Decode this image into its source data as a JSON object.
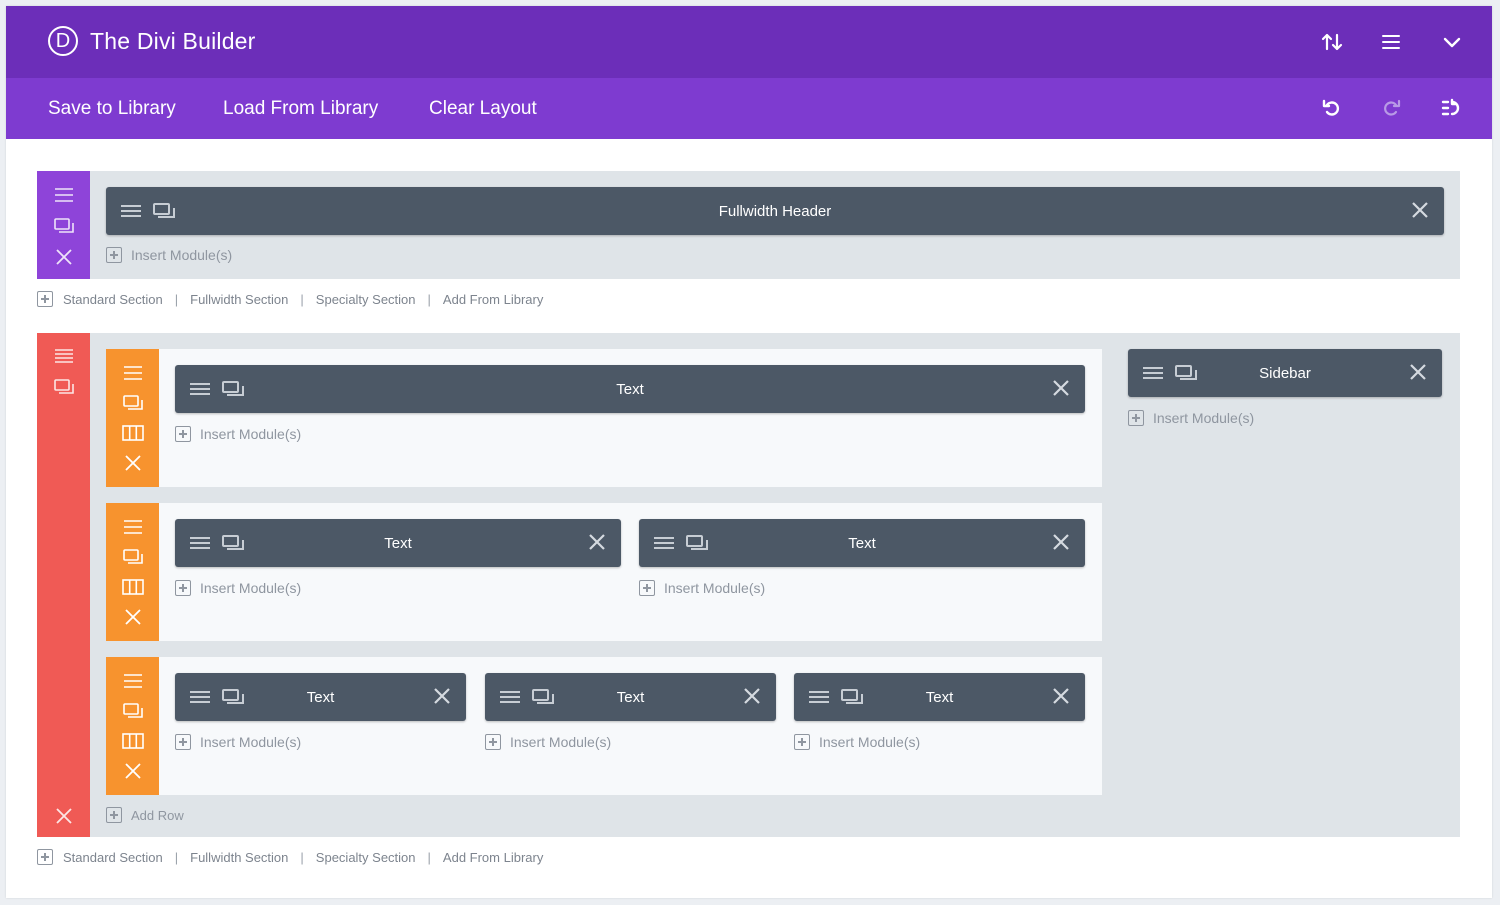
{
  "app": {
    "title": "The Divi Builder",
    "logo_letter": "D"
  },
  "colors": {
    "topbar": "#6c2eb9",
    "menubar": "#7e3bd0",
    "fullwidth_section": "#8e44d9",
    "specialty_section": "#f05a55",
    "row": "#f7932e",
    "module": "#4c5866"
  },
  "topbar_icons": [
    "sort-icon",
    "hamburger-icon",
    "chevron-down-icon"
  ],
  "menu": {
    "save_to_library": "Save to Library",
    "load_from_library": "Load From Library",
    "clear_layout": "Clear Layout"
  },
  "toolbar_icons": [
    "undo-icon",
    "redo-icon",
    "history-icon"
  ],
  "section1": {
    "module_name": "Fullwidth Header",
    "insert_label": "Insert Module(s)"
  },
  "add_section_links": {
    "standard": "Standard Section",
    "fullwidth": "Fullwidth Section",
    "specialty": "Specialty Section",
    "library": "Add From Library",
    "separator": "|"
  },
  "section2": {
    "rows": [
      {
        "modules": [
          {
            "name": "Text"
          }
        ]
      },
      {
        "modules": [
          {
            "name": "Text"
          },
          {
            "name": "Text"
          }
        ]
      },
      {
        "modules": [
          {
            "name": "Text"
          },
          {
            "name": "Text"
          },
          {
            "name": "Text"
          }
        ]
      }
    ],
    "insert_label": "Insert Module(s)",
    "add_row_label": "Add Row",
    "sidebar": {
      "module_name": "Sidebar",
      "insert_label": "Insert Module(s)"
    }
  }
}
